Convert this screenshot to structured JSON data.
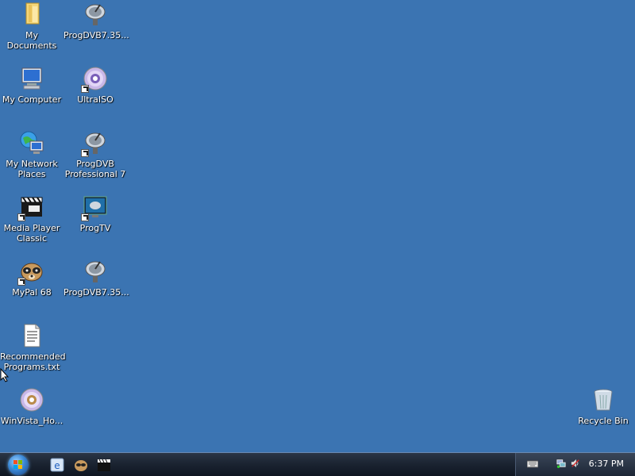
{
  "desktop_icons": {
    "my_documents": "My Documents",
    "progdvb1": "ProgDVB7.35...",
    "my_computer": "My Computer",
    "ultraiso": "UltraISO",
    "my_network": "My Network\nPlaces",
    "progdvb_pro": "ProgDVB\nProfessional 7",
    "mpc": "Media Player\nClassic",
    "progtv": "ProgTV",
    "mypal": "MyPal 68",
    "progdvb2": "ProgDVB7.35...",
    "recommended": "Recommended\nPrograms.txt",
    "winvista": "WinVista_Ho...",
    "recycle_bin": "Recycle Bin"
  },
  "taskbar": {
    "clock": "6:37 PM"
  },
  "icons": {
    "start": "windows-orb-icon",
    "quicklaunch": [
      "ie-icon",
      "mypal-icon",
      "media-player-classic-icon"
    ],
    "tray": [
      "keyboard-icon",
      "network-icon",
      "volume-icon"
    ]
  }
}
